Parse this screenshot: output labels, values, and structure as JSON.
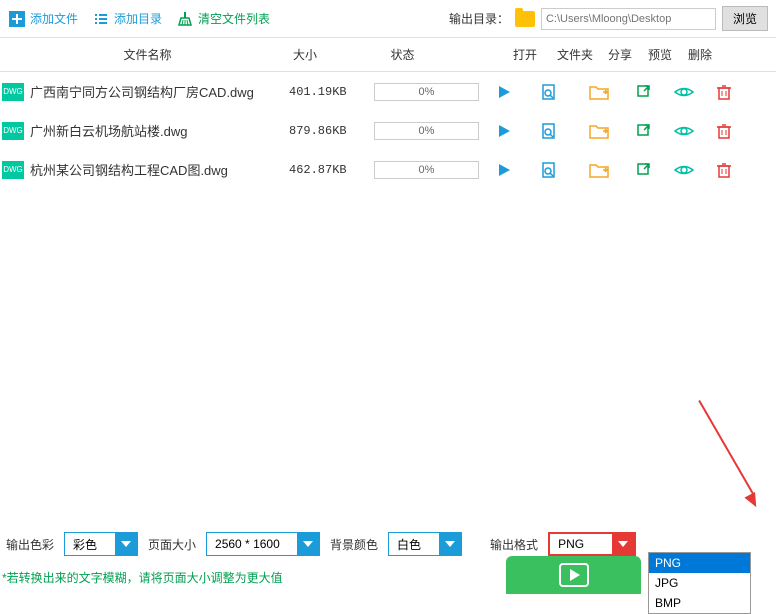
{
  "toolbar": {
    "add_file": "添加文件",
    "add_folder": "添加目录",
    "clear_list": "清空文件列表",
    "output_dir": "输出目录：",
    "path_placeholder": "C:\\Users\\Mloong\\Desktop",
    "browse": "浏览"
  },
  "headers": {
    "name": "文件名称",
    "size": "大小",
    "status": "状态",
    "open": "打开",
    "folder": "文件夹",
    "share": "分享",
    "preview": "预览",
    "delete": "删除"
  },
  "files": [
    {
      "badge": "DWG",
      "name": "广西南宁同方公司钢结构厂房CAD.dwg",
      "size": "401.19KB",
      "progress": "0%"
    },
    {
      "badge": "DWG",
      "name": "广州新白云机场航站楼.dwg",
      "size": "879.86KB",
      "progress": "0%"
    },
    {
      "badge": "DWG",
      "name": "杭州某公司钢结构工程CAD图.dwg",
      "size": "462.87KB",
      "progress": "0%"
    }
  ],
  "bottom": {
    "color_label": "输出色彩",
    "color_value": "彩色",
    "page_label": "页面大小",
    "page_value": "2560 * 1600",
    "bg_label": "背景颜色",
    "bg_value": "白色",
    "format_label": "输出格式",
    "format_value": "PNG"
  },
  "dropdown": {
    "options": [
      "PNG",
      "JPG",
      "BMP"
    ],
    "selected": "PNG"
  },
  "hint": "*若转换出来的文字模糊，请将页面大小调整为更大值"
}
